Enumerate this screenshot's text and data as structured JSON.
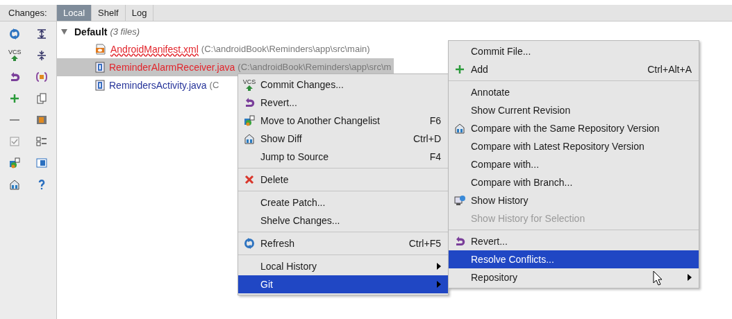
{
  "tabs_label": "Changes:",
  "tabs": [
    {
      "label": "Local",
      "selected": true
    },
    {
      "label": "Shelf",
      "selected": false
    },
    {
      "label": "Log",
      "selected": false
    }
  ],
  "toolbar_vcs_label": "VCS",
  "changelist": {
    "name": "Default",
    "count": "(3 files)",
    "expanded": true,
    "files": [
      {
        "name": "AndroidManifest.xml",
        "path": "(C:\\androidBook\\Reminders\\app\\src\\main)",
        "color": "#e2242b",
        "underlined": true,
        "selected": false
      },
      {
        "name": "ReminderAlarmReceiver.java",
        "path": "(C:\\androidBook\\Reminders\\app\\src\\m",
        "color": "#e2242b",
        "underlined": false,
        "selected": true
      },
      {
        "name": "RemindersActivity.java",
        "path": "(C",
        "color": "#26349a",
        "underlined": false,
        "selected": false
      }
    ]
  },
  "context_menu": [
    {
      "kind": "item",
      "label": "Commit Changes...",
      "icon_label": "VCS",
      "submenu": false,
      "selected": false,
      "disabled": false
    },
    {
      "kind": "item",
      "label": "Revert...",
      "submenu": false,
      "selected": false,
      "disabled": false
    },
    {
      "kind": "item",
      "label": "Move to Another Changelist",
      "shortcut": "F6",
      "submenu": false,
      "selected": false,
      "disabled": false
    },
    {
      "kind": "item",
      "label": "Show Diff",
      "shortcut": "Ctrl+D",
      "submenu": false,
      "selected": false,
      "disabled": false
    },
    {
      "kind": "item",
      "label": "Jump to Source",
      "shortcut": "F4",
      "submenu": false,
      "selected": false,
      "disabled": false
    },
    {
      "kind": "separator"
    },
    {
      "kind": "item",
      "label": "Delete",
      "submenu": false,
      "selected": false,
      "disabled": false
    },
    {
      "kind": "separator"
    },
    {
      "kind": "item",
      "label": "Create Patch...",
      "submenu": false,
      "selected": false,
      "disabled": false
    },
    {
      "kind": "item",
      "label": "Shelve Changes...",
      "submenu": false,
      "selected": false,
      "disabled": false
    },
    {
      "kind": "separator"
    },
    {
      "kind": "item",
      "label": "Refresh",
      "shortcut": "Ctrl+F5",
      "submenu": false,
      "selected": false,
      "disabled": false
    },
    {
      "kind": "separator"
    },
    {
      "kind": "item",
      "label": "Local History",
      "submenu": true,
      "selected": false,
      "disabled": false
    },
    {
      "kind": "item",
      "label": "Git",
      "submenu": true,
      "selected": true,
      "disabled": false
    }
  ],
  "git_submenu": [
    {
      "kind": "item",
      "label": "Commit File...",
      "submenu": false,
      "selected": false,
      "disabled": false
    },
    {
      "kind": "item",
      "label": "Add",
      "shortcut": "Ctrl+Alt+A",
      "submenu": false,
      "selected": false,
      "disabled": false
    },
    {
      "kind": "separator"
    },
    {
      "kind": "item",
      "label": "Annotate",
      "submenu": false,
      "selected": false,
      "disabled": false
    },
    {
      "kind": "item",
      "label": "Show Current Revision",
      "submenu": false,
      "selected": false,
      "disabled": false
    },
    {
      "kind": "item",
      "label": "Compare with the Same Repository Version",
      "submenu": false,
      "selected": false,
      "disabled": false
    },
    {
      "kind": "item",
      "label": "Compare with Latest Repository Version",
      "submenu": false,
      "selected": false,
      "disabled": false
    },
    {
      "kind": "item",
      "label": "Compare with...",
      "submenu": false,
      "selected": false,
      "disabled": false
    },
    {
      "kind": "item",
      "label": "Compare with Branch...",
      "submenu": false,
      "selected": false,
      "disabled": false
    },
    {
      "kind": "item",
      "label": "Show History",
      "submenu": false,
      "selected": false,
      "disabled": false
    },
    {
      "kind": "item",
      "label": "Show History for Selection",
      "submenu": false,
      "selected": false,
      "disabled": true
    },
    {
      "kind": "separator"
    },
    {
      "kind": "item",
      "label": "Revert...",
      "submenu": false,
      "selected": false,
      "disabled": false
    },
    {
      "kind": "item",
      "label": "Resolve Conflicts...",
      "submenu": false,
      "selected": true,
      "disabled": false
    },
    {
      "kind": "item",
      "label": "Repository",
      "submenu": true,
      "selected": false,
      "disabled": false
    }
  ]
}
